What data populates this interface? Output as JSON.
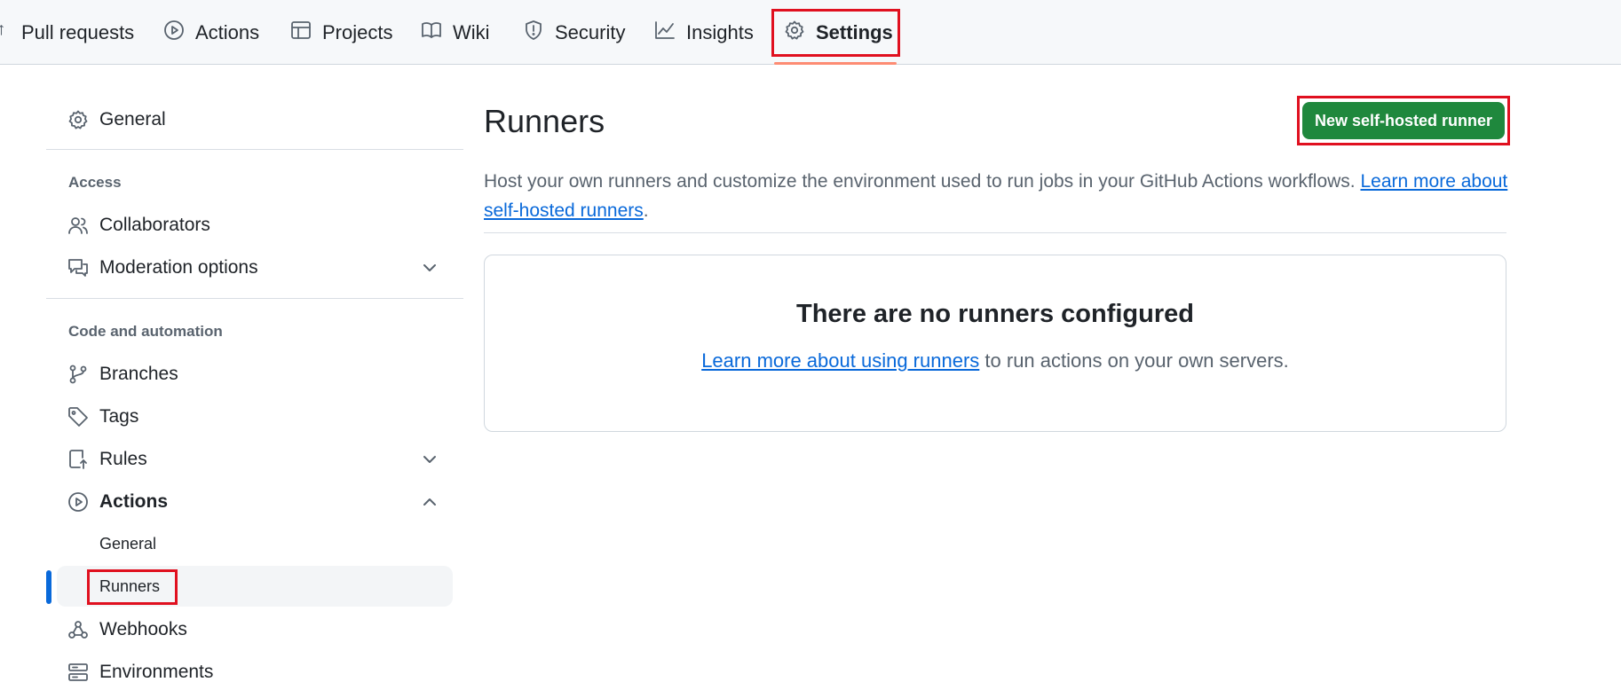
{
  "tabs": [
    {
      "label": "Pull requests",
      "icon": "pull-request-icon"
    },
    {
      "label": "Actions",
      "icon": "play-icon"
    },
    {
      "label": "Projects",
      "icon": "table-icon"
    },
    {
      "label": "Wiki",
      "icon": "book-icon"
    },
    {
      "label": "Security",
      "icon": "shield-icon"
    },
    {
      "label": "Insights",
      "icon": "graph-icon"
    },
    {
      "label": "Settings",
      "icon": "gear-icon",
      "selected": true
    }
  ],
  "sidebar": {
    "general": {
      "label": "General",
      "icon": "gear-icon"
    },
    "sections": [
      {
        "title": "Access",
        "items": [
          {
            "label": "Collaborators",
            "icon": "people-icon"
          },
          {
            "label": "Moderation options",
            "icon": "comment-discussion-icon",
            "expandable": true
          }
        ]
      },
      {
        "title": "Code and automation",
        "items": [
          {
            "label": "Branches",
            "icon": "branch-icon"
          },
          {
            "label": "Tags",
            "icon": "tag-icon"
          },
          {
            "label": "Rules",
            "icon": "repo-push-icon",
            "expandable": true
          },
          {
            "label": "Actions",
            "icon": "play-icon",
            "expandable": true,
            "expanded": true,
            "children": [
              {
                "label": "General"
              },
              {
                "label": "Runners",
                "selected": true
              }
            ]
          },
          {
            "label": "Webhooks",
            "icon": "webhook-icon"
          },
          {
            "label": "Environments",
            "icon": "server-icon"
          }
        ]
      }
    ]
  },
  "main": {
    "title": "Runners",
    "new_runner_button": "New self-hosted runner",
    "description": "Host your own runners and customize the environment used to run jobs in your GitHub Actions workflows.",
    "description_link": "Learn more about self-hosted runners",
    "empty_state": {
      "title": "There are no runners configured",
      "link": "Learn more about using runners",
      "text": "to run actions on your own servers."
    }
  },
  "colors": {
    "primary_button": "#1f883d",
    "link": "#0969da",
    "selected_underline": "#fd8c73",
    "active_indicator": "#0969da",
    "highlight_outline": "#e0101f"
  }
}
